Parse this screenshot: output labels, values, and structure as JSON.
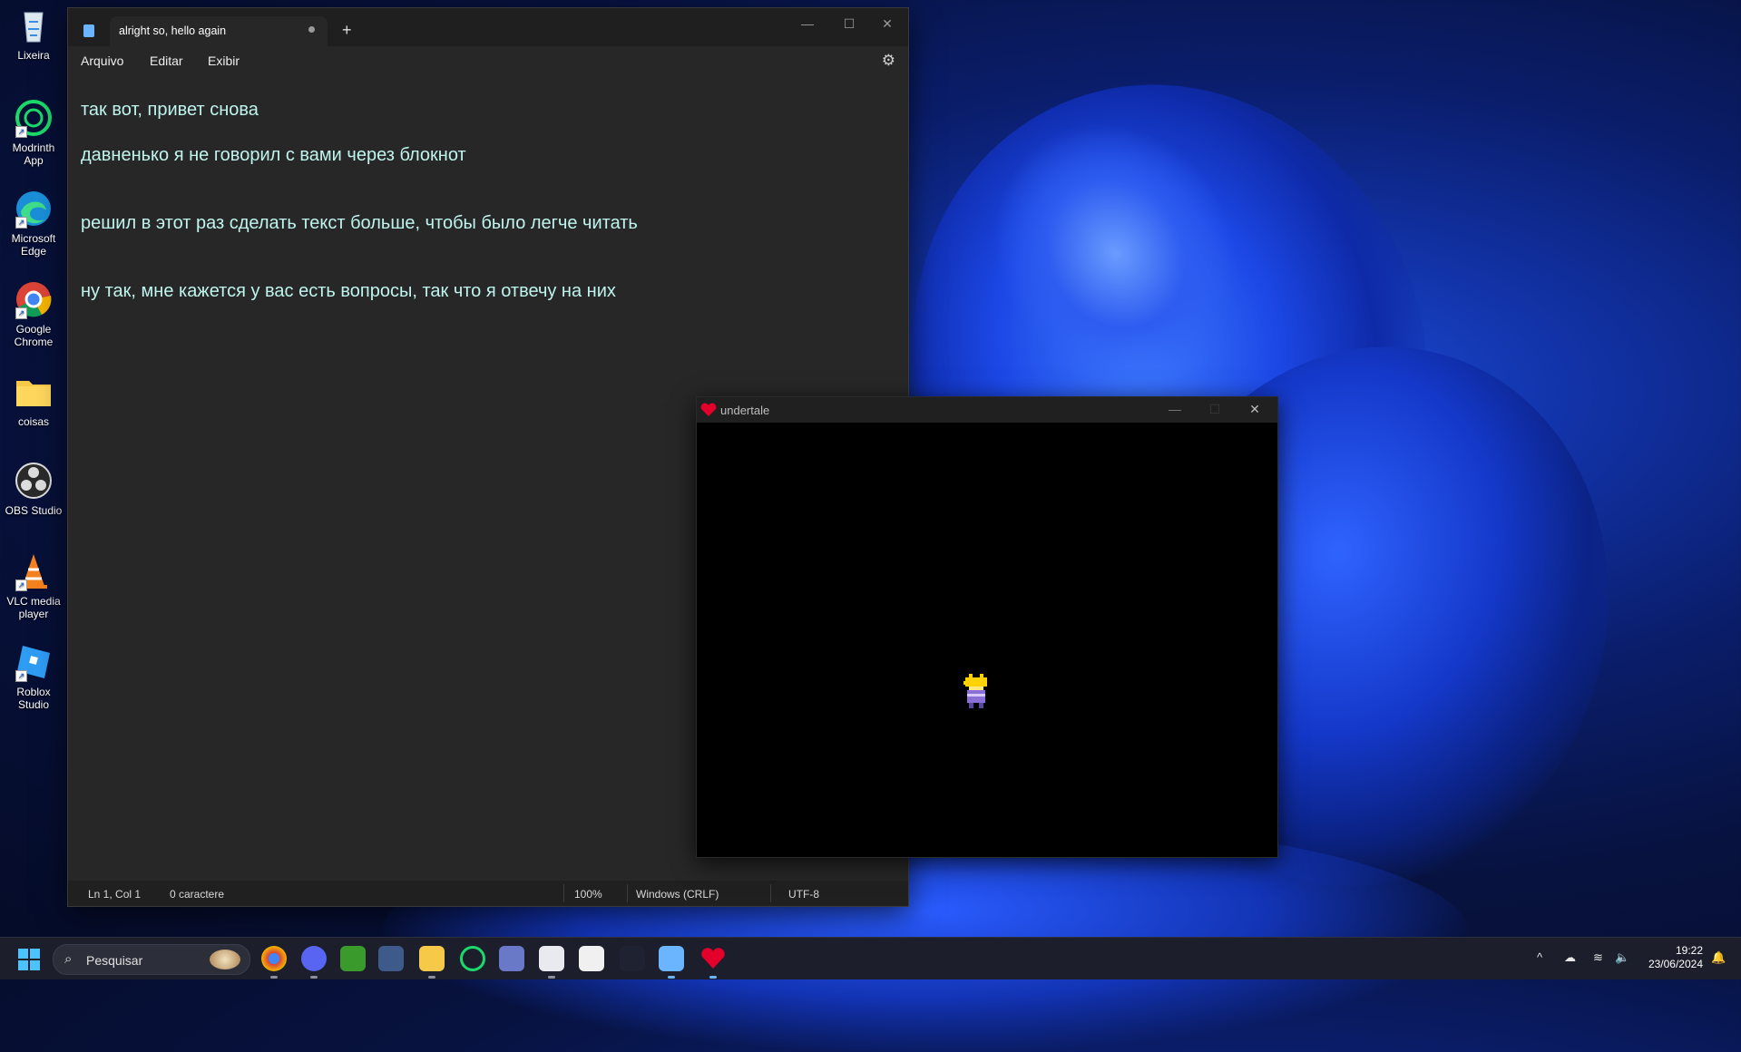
{
  "desktop": {
    "icons": [
      {
        "label": "Lixeira"
      },
      {
        "label": "Modrinth App"
      },
      {
        "label": "Microsoft Edge"
      },
      {
        "label": "Google Chrome"
      },
      {
        "label": "coisas"
      },
      {
        "label": "OBS Studio"
      },
      {
        "label": "VLC media player"
      },
      {
        "label": "Roblox Studio"
      }
    ]
  },
  "notepad": {
    "tab_title": "alright so, hello again",
    "menu": {
      "file": "Arquivo",
      "edit": "Editar",
      "view": "Exibir"
    },
    "lines": [
      "так вот, привет снова",
      "давненько я не говорил с вами через блокнот",
      "решил в этот раз сделать текст больше, чтобы было легче читать",
      "ну так, мне кажется у вас есть вопросы, так что я отвечу на них"
    ],
    "status": {
      "position": "Ln 1, Col 1",
      "chars": "0 caractere",
      "zoom": "100%",
      "line_ending": "Windows (CRLF)",
      "encoding": "UTF-8"
    },
    "text_color": "#bff4ee"
  },
  "undertale": {
    "title": "undertale"
  },
  "taskbar": {
    "search_placeholder": "Pesquisar",
    "time": "19:22",
    "date": "23/06/2024"
  }
}
